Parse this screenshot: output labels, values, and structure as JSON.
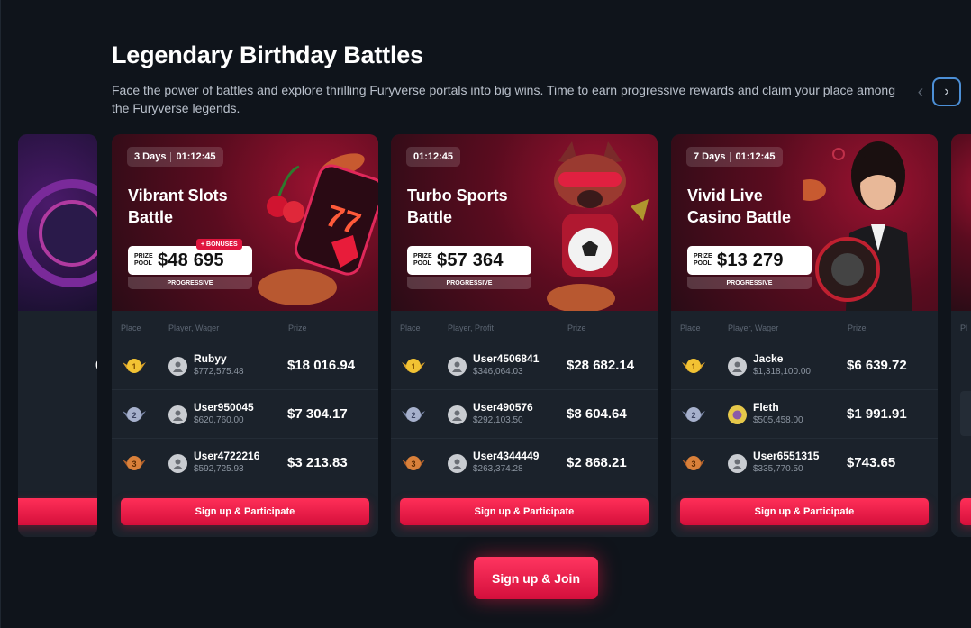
{
  "header": {
    "title": "Legendary Birthday Battles",
    "description": "Face the power of battles and explore thrilling Furyverse portals into big wins. Time to earn progressive rewards and claim your place among the Furyverse legends."
  },
  "nav": {
    "prev_icon": "chevron-left-icon",
    "next_icon": "chevron-right-icon",
    "prev_glyph": "‹",
    "next_glyph": "›"
  },
  "cards": [
    {
      "timer_days": "3 Days",
      "timer_time": "01:12:45",
      "name": "Vibrant Slots Battle",
      "pool_label": "PRIZE POOL",
      "pool_amount": "$48 695",
      "bonus": "+ BONUSES",
      "progressive": "PROGRESSIVE",
      "columns": [
        "Place",
        "Player, Wager",
        "Prize"
      ],
      "rows": [
        {
          "player": "Rubyy",
          "wager": "$772,575.48",
          "prize": "$18 016.94"
        },
        {
          "player": "User950045",
          "wager": "$620,760.00",
          "prize": "$7 304.17"
        },
        {
          "player": "User4722216",
          "wager": "$592,725.93",
          "prize": "$3 213.83"
        }
      ],
      "cta": "Sign up & Participate"
    },
    {
      "timer_days": "",
      "timer_time": "01:12:45",
      "name": "Turbo Sports Battle",
      "pool_label": "PRIZE POOL",
      "pool_amount": "$57 364",
      "bonus": "",
      "progressive": "PROGRESSIVE",
      "columns": [
        "Place",
        "Player, Profit",
        "Prize"
      ],
      "rows": [
        {
          "player": "User4506841",
          "wager": "$346,064.03",
          "prize": "$28 682.14"
        },
        {
          "player": "User490576",
          "wager": "$292,103.50",
          "prize": "$8 604.64"
        },
        {
          "player": "User4344449",
          "wager": "$263,374.28",
          "prize": "$2 868.21"
        }
      ],
      "cta": "Sign up & Participate"
    },
    {
      "timer_days": "7 Days",
      "timer_time": "01:12:45",
      "name": "Vivid Live Casino Battle",
      "pool_label": "PRIZE POOL",
      "pool_amount": "$13 279",
      "bonus": "",
      "progressive": "PROGRESSIVE",
      "columns": [
        "Place",
        "Player, Wager",
        "Prize"
      ],
      "rows": [
        {
          "player": "Jacke",
          "wager": "$1,318,100.00",
          "prize": "$6 639.72"
        },
        {
          "player": "Fleth",
          "wager": "$505,458.00",
          "prize": "$1 991.91"
        },
        {
          "player": "User6551315",
          "wager": "$335,770.50",
          "prize": "$743.65"
        }
      ],
      "cta": "Sign up & Participate"
    }
  ],
  "peek_left_fragment": "0",
  "peek_right_fragment": "Pl",
  "join_button": "Sign up & Join",
  "colors": {
    "accent": "#e0163f",
    "background": "#0f141b",
    "card": "#1b222b"
  }
}
